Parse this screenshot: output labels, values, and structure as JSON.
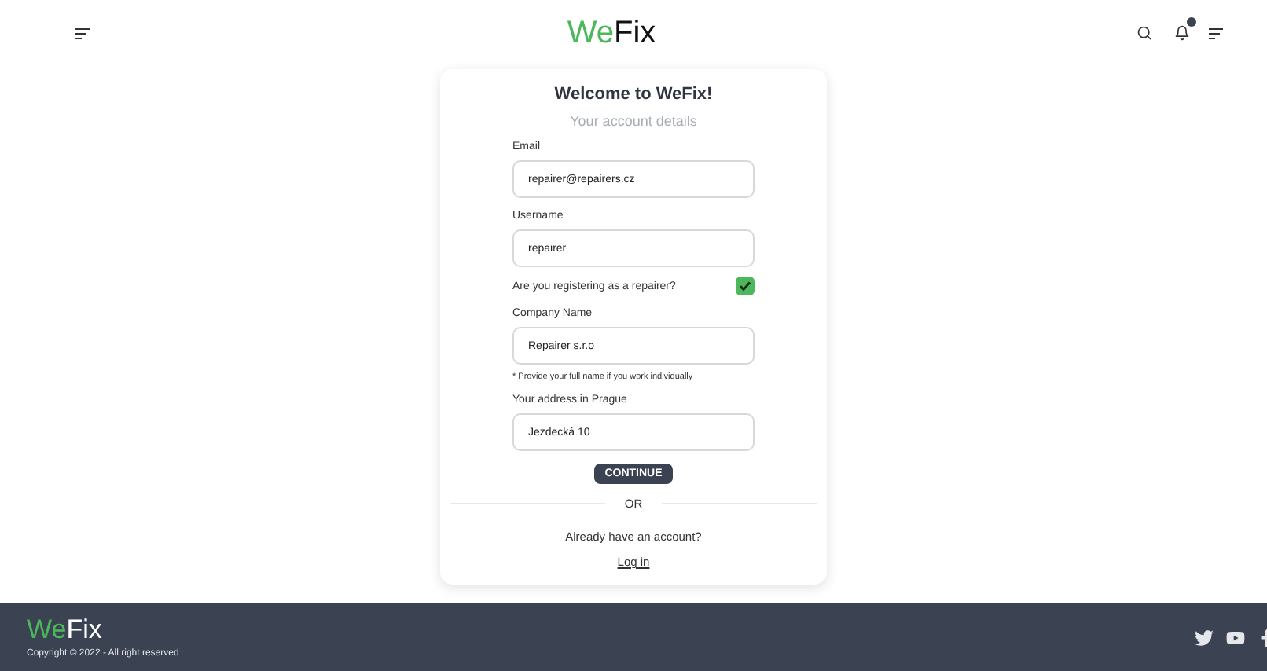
{
  "header": {
    "logo": {
      "accent": "We",
      "rest": "Fix"
    },
    "notification_dot": true
  },
  "form": {
    "title": "Welcome to WeFix!",
    "subtitle": "Your account details",
    "fields": [
      {
        "label": "Email",
        "value": "repairer@repairers.cz"
      },
      {
        "label": "Username",
        "value": "repairer"
      }
    ],
    "repairer_check": {
      "label": "Are you registering as a repairer?",
      "checked": true
    },
    "company_fields": [
      {
        "label": "Company Name",
        "value": "Repairer s.r.o",
        "hint": "* Provide your full name if you work individually"
      },
      {
        "label": "Your address in Prague",
        "value": "Jezdecká 10"
      }
    ],
    "continue_button": "CONTINUE",
    "divider": "OR",
    "login_prompt": "Already have an account?",
    "login_link": "Log in"
  },
  "footer": {
    "logo": {
      "accent": "We",
      "rest": "Fix"
    },
    "copyright": "Copyright © 2022 - All right reserved"
  }
}
